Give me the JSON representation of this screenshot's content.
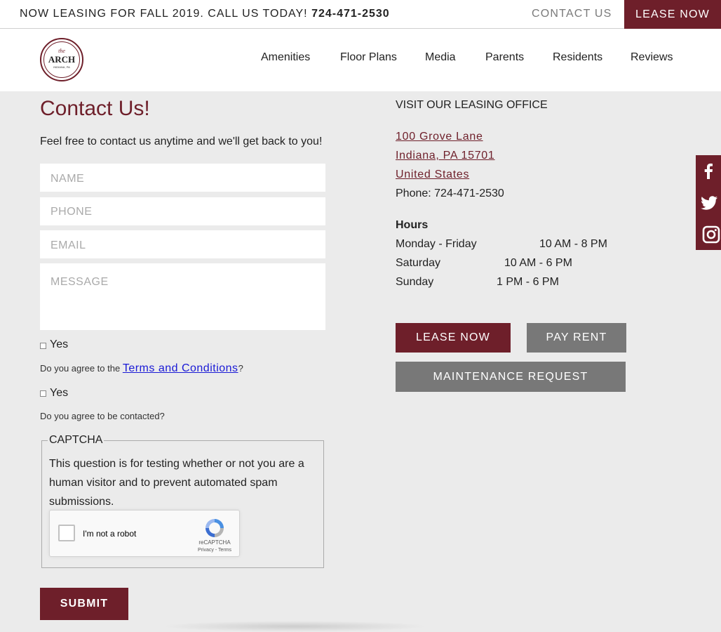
{
  "topbar": {
    "promo_text": "NOW LEASING FOR FALL 2019. CALL US TODAY!",
    "promo_phone": "724-471-2530",
    "contact_label": "CONTACT US",
    "lease_label": "LEASE NOW"
  },
  "logo": {
    "the": "the",
    "name": "ARCH",
    "sub": "INDIANA, PA"
  },
  "nav": {
    "items": [
      "Amenities",
      "Floor Plans",
      "Media",
      "Parents",
      "Residents",
      "Reviews"
    ]
  },
  "form": {
    "title": "Contact Us!",
    "intro": "Feel free to contact us anytime and we'll get back to you!",
    "name_placeholder": "NAME",
    "phone_placeholder": "PHONE",
    "email_placeholder": "EMAIL",
    "message_placeholder": "MESSAGE",
    "terms_check_label": "Yes",
    "terms_prefix": "Do you agree to the ",
    "terms_link": "Terms and Conditions",
    "terms_suffix": "?",
    "contact_check_label": "Yes",
    "contact_question": "Do you agree to be contacted?",
    "captcha_legend": "CAPTCHA",
    "captcha_text": "This question is for testing whether or not you are a human visitor and to prevent automated spam submissions.",
    "recaptcha_label": "I'm not a robot",
    "recaptcha_brand": "reCAPTCHA",
    "recaptcha_privacy": "Privacy - Terms",
    "submit_label": "SUBMIT"
  },
  "office": {
    "title": "VISIT OUR LEASING OFFICE",
    "address_line1": "100 Grove Lane",
    "address_line2": "Indiana, PA 15701",
    "address_line3": "United States",
    "phone": "Phone: 724-471-2530",
    "hours_title": "Hours",
    "hours": [
      {
        "day": "Monday - Friday",
        "time": "10 AM - 8 PM"
      },
      {
        "day": "Saturday",
        "time": "10 AM - 6 PM"
      },
      {
        "day": "Sunday",
        "time": "1 PM - 6 PM"
      }
    ],
    "lease_button": "LEASE NOW",
    "pay_button": "PAY RENT",
    "maintenance_button": "MAINTENANCE REQUEST"
  },
  "social": {
    "icons": [
      "facebook-icon",
      "twitter-icon",
      "instagram-icon"
    ]
  },
  "colors": {
    "brand": "#6e1f2a",
    "gray_button": "#787878",
    "background": "#ebebeb"
  }
}
